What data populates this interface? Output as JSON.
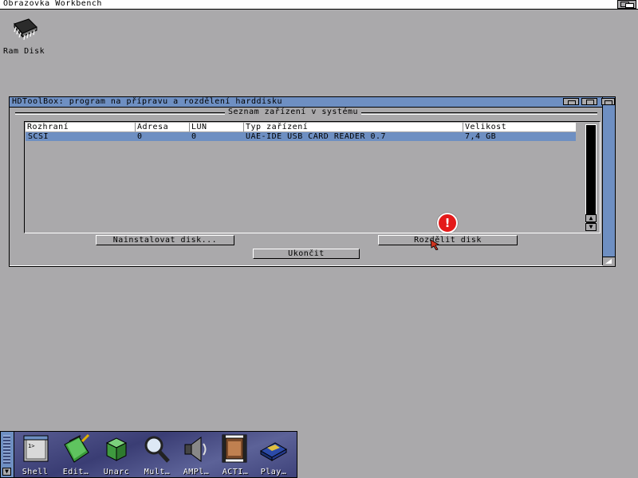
{
  "screen": {
    "title": "Obrazovka Workbench"
  },
  "desktop": {
    "icons": [
      {
        "label": "Ram Disk",
        "icon": "chip-icon"
      }
    ]
  },
  "window": {
    "title": "HDToolBox: program na přípravu a rozdělení harddisku",
    "group_label": "Seznam zařízení v systému",
    "columns": [
      "Rozhraní",
      "Adresa",
      "LUN",
      "Typ zařízení",
      "Velikost"
    ],
    "rows": [
      {
        "interface": "SCSI",
        "address": "0",
        "lun": "0",
        "type": "UAE-IDE USB CARD READER 0.7",
        "size": "7,4 GB"
      }
    ],
    "buttons": {
      "install": "Nainstalovat disk...",
      "partition": "Rozdělit disk",
      "quit": "Ukončit"
    },
    "scroll_up": "▲",
    "scroll_down": "▼"
  },
  "alert": {
    "symbol": "!",
    "color": "#e41a1a"
  },
  "dock": {
    "items": [
      {
        "label": "Shell",
        "icon": "shell-icon"
      },
      {
        "label": "Edit…",
        "icon": "notepad-icon"
      },
      {
        "label": "Unarc",
        "icon": "cube-icon"
      },
      {
        "label": "Mult…",
        "icon": "magnifier-icon"
      },
      {
        "label": "AMPl…",
        "icon": "speaker-icon"
      },
      {
        "label": "ACTI…",
        "icon": "film-icon"
      },
      {
        "label": "Play…",
        "icon": "disc-icon"
      }
    ]
  },
  "colors": {
    "background": "#aaa9ab",
    "title_blue": "#6e8fc2",
    "dock": "#3a3d74"
  }
}
